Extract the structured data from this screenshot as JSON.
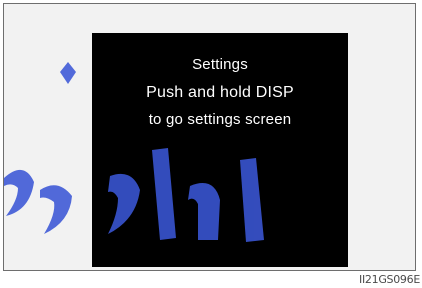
{
  "display": {
    "line1": "Settings",
    "line2": "Push and hold DISP",
    "line3": "to go settings screen"
  },
  "watermark": {
    "text": "امداد خو"
  },
  "figure": {
    "code": "II21GS096E"
  },
  "colors": {
    "screen_bg": "#000000",
    "screen_text": "#ffffff",
    "panel_bg": "#f2f2f2",
    "watermark": "#3b57d6"
  }
}
